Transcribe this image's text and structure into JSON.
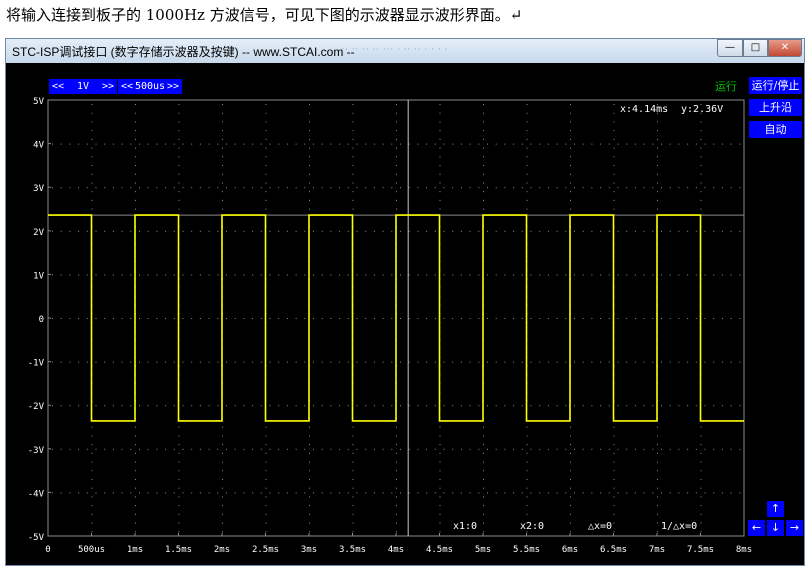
{
  "caption": "将输入连接到板子的 1000Hz 方波信号，可见下图的示波器显示波形界面。↵",
  "window": {
    "title": "STC-ISP调试接口 (数字存储示波器及按键) -- www.STCAI.com --",
    "title_ghost": "·· ·· ·· ··  ···  ·  ··   ··   ·   ·   ·   ·",
    "minimize_glyph": "—",
    "maximize_glyph": "□",
    "close_glyph": "✕"
  },
  "toolbar": {
    "volt_prev": "<<",
    "volt_value": "1V",
    "volt_next": ">>",
    "time_prev": "<<",
    "time_value": "500us",
    "time_next": ">>",
    "status": "运行",
    "run_stop": "运行/停止",
    "trigger_edge": "上升沿",
    "trigger_mode": "自动"
  },
  "readouts": {
    "cursor_x": "x:4.14ms",
    "cursor_y": "y:2.36V",
    "x1": "x1:0",
    "x2": "x2:0",
    "dx": "△x=0",
    "inv_dx": "1/△x=0"
  },
  "nav_arrows": {
    "up": "↑",
    "left": "←",
    "down": "↓",
    "right": "→"
  },
  "colors": {
    "trace": "#ffff00",
    "grid_dots": "#909090",
    "screen_bg": "#000000",
    "button_bg": "#0000ff",
    "status": "#00c000"
  },
  "chart_data": {
    "type": "line",
    "xlabel": "",
    "ylabel": "",
    "xlim_ms": [
      0,
      8
    ],
    "ylim_v": [
      -5,
      5
    ],
    "y_ticks": [
      "5V",
      "4V",
      "3V",
      "2V",
      "1V",
      "0",
      "-1V",
      "-2V",
      "-3V",
      "-4V",
      "-5V"
    ],
    "x_ticks": [
      "0",
      "500us",
      "1ms",
      "1.5ms",
      "2ms",
      "2.5ms",
      "3ms",
      "3.5ms",
      "4ms",
      "4.5ms",
      "5ms",
      "5.5ms",
      "6ms",
      "6.5ms",
      "7ms",
      "7.5ms",
      "8ms"
    ],
    "cursor_x_ms": 4.14,
    "cursor_y_v": 2.36,
    "series": [
      {
        "x_ms": [
          0,
          0.5,
          0.5,
          1.0,
          1.0,
          1.5,
          1.5,
          2.0,
          2.0,
          2.5,
          2.5,
          3.0,
          3.0,
          3.5,
          3.5,
          4.0,
          4.0,
          4.5,
          4.5,
          5.0,
          5.0,
          5.5,
          5.5,
          6.0,
          6.0,
          6.5,
          6.5,
          7.0,
          7.0,
          7.5,
          7.5,
          8.0
        ],
        "y_v": [
          2.36,
          2.36,
          -2.36,
          -2.36,
          2.36,
          2.36,
          -2.36,
          -2.36,
          2.36,
          2.36,
          -2.36,
          -2.36,
          2.36,
          2.36,
          -2.36,
          -2.36,
          2.36,
          2.36,
          -2.36,
          -2.36,
          2.36,
          2.36,
          -2.36,
          -2.36,
          2.36,
          2.36,
          -2.36,
          -2.36,
          2.36,
          2.36,
          -2.36,
          -2.36
        ]
      }
    ]
  }
}
